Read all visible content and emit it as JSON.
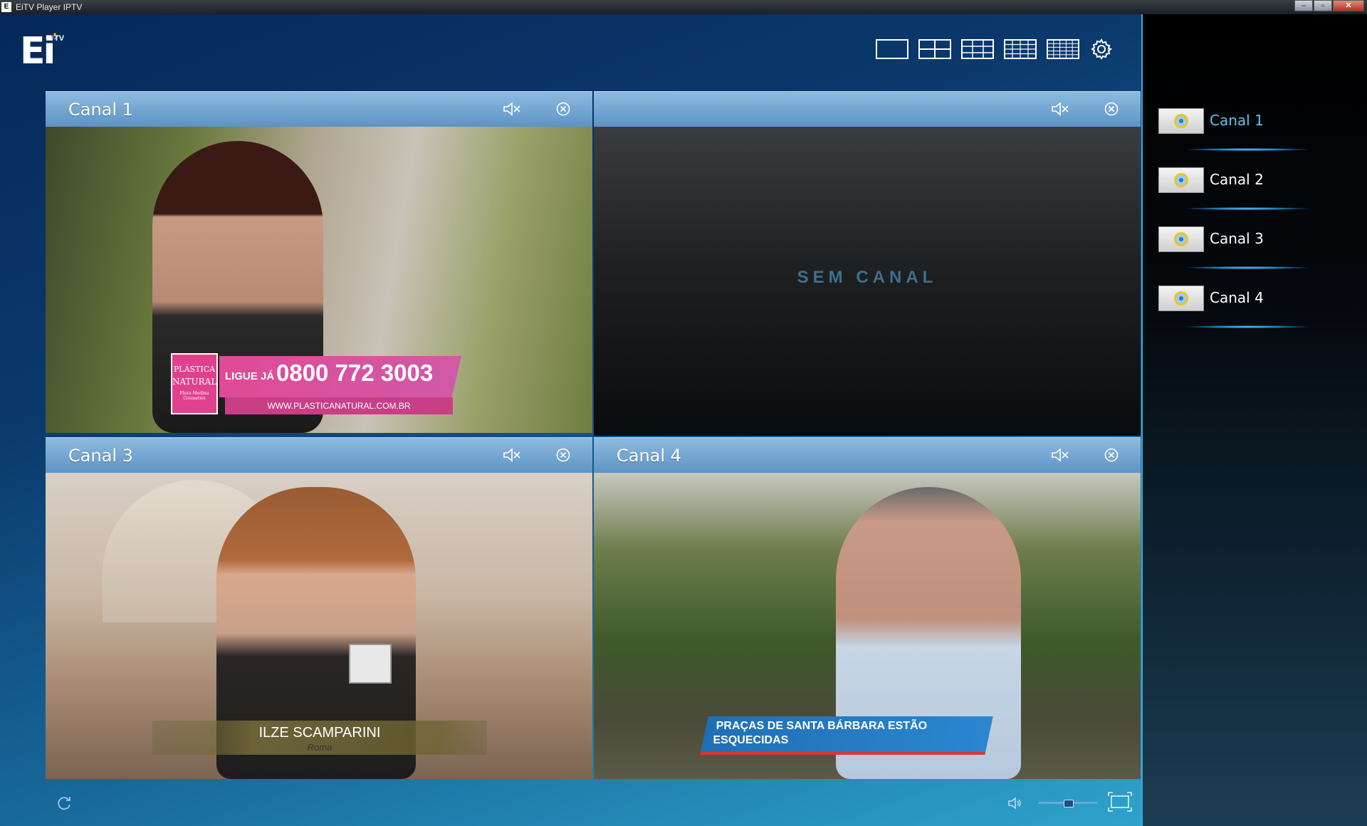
{
  "window": {
    "title": "EiTV Player IPTV",
    "buttons": {
      "minimize": "–",
      "maximize": "▫",
      "close": "✕"
    }
  },
  "logo": {
    "text": "Ei",
    "superscript": "TV"
  },
  "icons": {
    "layouts": [
      "layout-1x1-icon",
      "layout-2x2-icon",
      "layout-3x3-icon",
      "layout-4x4-icon",
      "layout-5x5-icon"
    ],
    "settings": "gear-icon",
    "mute": "speaker-mute-icon",
    "close": "circle-close-icon",
    "refresh": "refresh-icon",
    "volume": "volume-icon",
    "fullscreen": "fullscreen-icon"
  },
  "colors": {
    "accent": "#5ec6f0",
    "panel_header": "#7aa9d4",
    "no_channel_text": "#3f6f8e"
  },
  "panels": [
    {
      "name": "Canal 1",
      "overlay": {
        "brand_line1": "PLÁSTICA",
        "brand_line2": "NATURAL",
        "brand_line3": "Flora Medina Cosmetics",
        "call": "LIGUE JÁ",
        "phone": "0800 772 3003",
        "url": "WWW.PLASTICANATURAL.COM.BR"
      }
    },
    {
      "name": "",
      "empty_message": "SEM CANAL"
    },
    {
      "name": "Canal 3",
      "overlay": {
        "reporter": "ILZE SCAMPARINI",
        "location": "Roma"
      }
    },
    {
      "name": "Canal 4",
      "overlay": {
        "headline_line1": "PRAÇAS DE SANTA BÁRBARA ESTÃO",
        "headline_line2": "ESQUECIDAS"
      }
    }
  ],
  "volume": {
    "level": 0.5
  },
  "channels": [
    {
      "label": "Canal 1",
      "active": true
    },
    {
      "label": "Canal 2",
      "active": false
    },
    {
      "label": "Canal 3",
      "active": false
    },
    {
      "label": "Canal 4",
      "active": false
    }
  ]
}
